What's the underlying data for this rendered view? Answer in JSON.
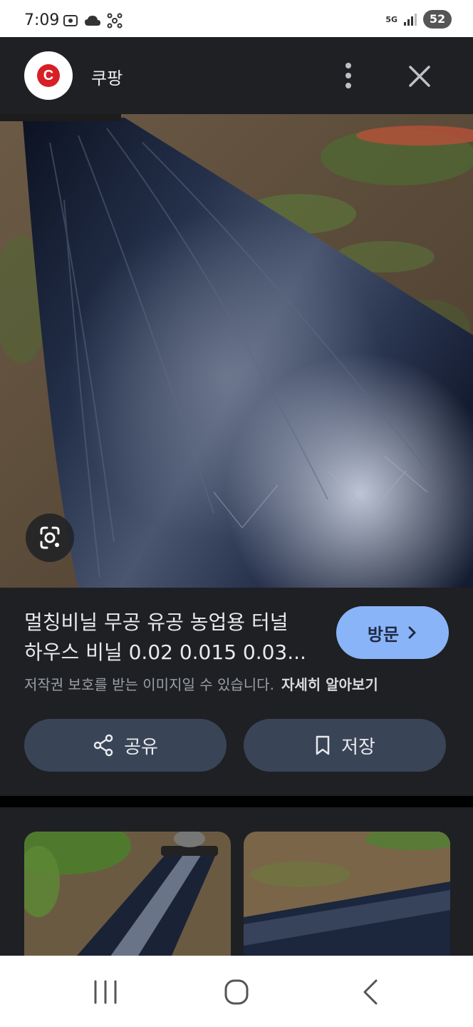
{
  "status_bar": {
    "time": "7:09",
    "network": "5G",
    "battery": "52"
  },
  "header": {
    "site_name": "쿠팡",
    "logo_letter": "C"
  },
  "result": {
    "title_line1": "멀칭비닐 무공 유공 농업용 터널",
    "title_line2": "하우스 비닐 0.02 0.015 0.03...",
    "visit_label": "방문",
    "copyright_text": "저작권 보호를 받는 이미지일 수 있습니다.",
    "learn_more": "자세히 알아보기",
    "share_label": "공유",
    "save_label": "저장"
  },
  "colors": {
    "panel_bg": "#1f2024",
    "visit_button": "#8ab4f8",
    "action_button": "#394457",
    "brand_red": "#d81f26"
  }
}
